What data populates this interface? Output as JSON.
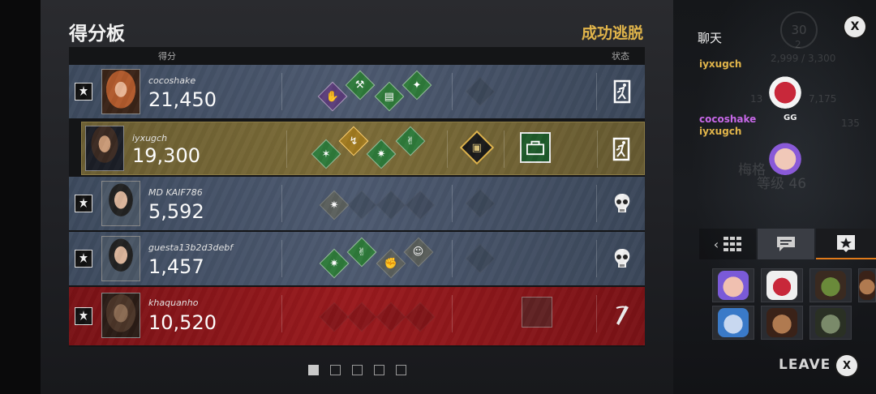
{
  "header": {
    "title": "得分板",
    "outcome": "成功逃脱",
    "col_score": "得分",
    "col_status": "状态"
  },
  "players": [
    {
      "name": "cocoshake",
      "score": "21,450"
    },
    {
      "name": "iyxugch",
      "score": "19,300"
    },
    {
      "name": "MD KAIF786",
      "score": "5,592"
    },
    {
      "name": "guesta13b2d3debf",
      "score": "1,457"
    },
    {
      "name": "khaquanho",
      "score": "10,520"
    }
  ],
  "pagination": {
    "pages": 5,
    "active": 1
  },
  "chat": {
    "title": "聊天",
    "messages": [
      {
        "sender": "iyxugch",
        "color": "#e0b44a",
        "emote": "demon-emote"
      },
      {
        "sender": "cocoshake",
        "color": "#c768e8",
        "text": "GG"
      },
      {
        "sender": "iyxugch",
        "color": "#e0b44a",
        "emote": "winking-face-emote"
      }
    ],
    "close_label": "X"
  },
  "background_stats": {
    "level": "30",
    "level_sub": "2",
    "points": "2,999 / 3,300",
    "stat_a": "13",
    "stat_b": "7,175",
    "stat_c": "135",
    "rank_label": "梅格",
    "rank_label2": "等级 46"
  },
  "footer": {
    "leave_label": "LEAVE",
    "leave_close": "X"
  },
  "colors": {
    "accent_gold": "#e0b44a",
    "survivor_row": "#4d5a70",
    "killer_row": "#9a1a1e",
    "self_row": "#7c6c38"
  }
}
